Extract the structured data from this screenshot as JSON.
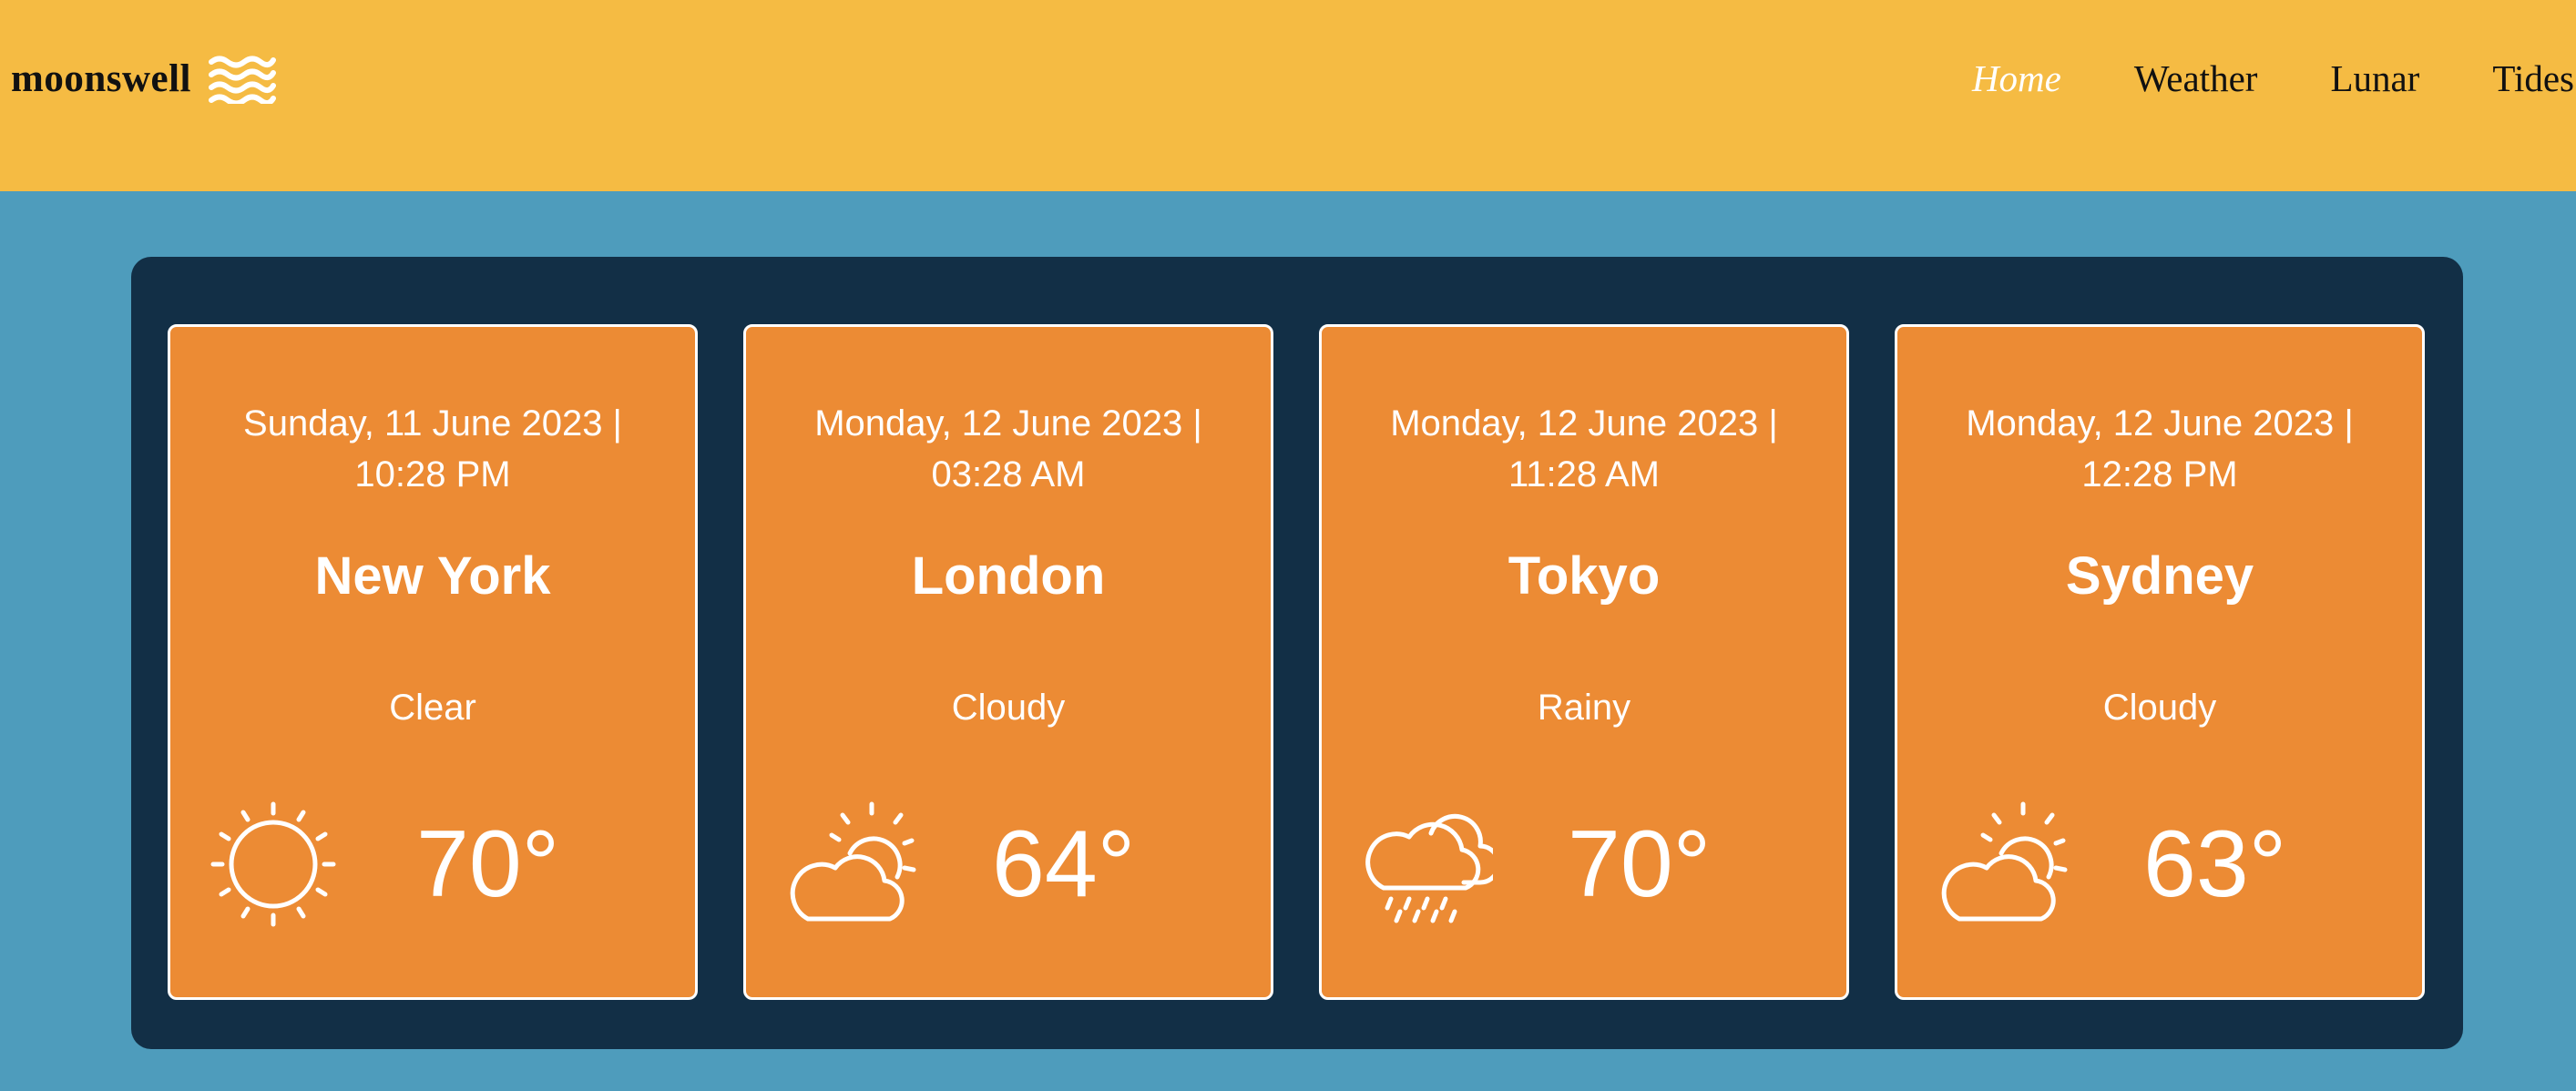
{
  "app": {
    "brand_name": "moonswell",
    "brand_icon": "waves-icon"
  },
  "nav": {
    "items": [
      {
        "label": "Home",
        "active": true
      },
      {
        "label": "Weather",
        "active": false
      },
      {
        "label": "Lunar",
        "active": false
      },
      {
        "label": "Tides",
        "active": false
      }
    ]
  },
  "colors": {
    "header": "#f5bb43",
    "background": "#4e9cbc",
    "panel": "#122f46",
    "card": "#ec8b34"
  },
  "cards": [
    {
      "date": "Sunday, 11 June 2023 | 10:28 PM",
      "city": "New York",
      "condition": "Clear",
      "temp": "70°",
      "icon": "sun-icon"
    },
    {
      "date": "Monday, 12 June 2023 | 03:28 AM",
      "city": "London",
      "condition": "Cloudy",
      "temp": "64°",
      "icon": "partly-cloudy-icon"
    },
    {
      "date": "Monday, 12 June 2023 | 11:28 AM",
      "city": "Tokyo",
      "condition": "Rainy",
      "temp": "70°",
      "icon": "rain-cloud-icon"
    },
    {
      "date": "Monday, 12 June 2023 | 12:28 PM",
      "city": "Sydney",
      "condition": "Cloudy",
      "temp": "63°",
      "icon": "partly-cloudy-icon"
    }
  ]
}
